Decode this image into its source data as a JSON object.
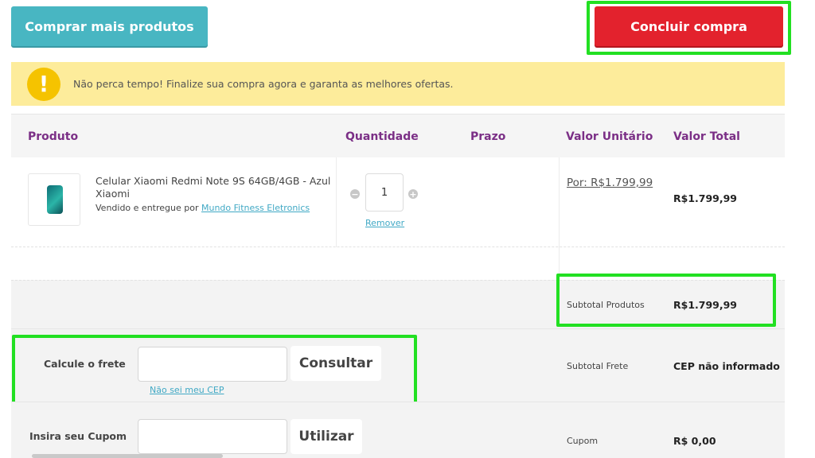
{
  "top": {
    "continue_label": "Comprar mais produtos",
    "finish_label": "Concluir compra"
  },
  "alert": {
    "icon": "!",
    "text": "Não perca tempo! Finalize sua compra agora e garanta as melhores ofertas."
  },
  "table": {
    "headers": {
      "product": "Produto",
      "quantity": "Quantidade",
      "deadline": "Prazo",
      "unit_price": "Valor Unitário",
      "total_price": "Valor Total"
    }
  },
  "item": {
    "name": "Celular Xiaomi Redmi Note 9S 64GB/4GB - Azul Xiaomi",
    "sold_by_prefix": "Vendido e entregue por",
    "seller": "Mundo Fitness Eletronics",
    "qty": "1",
    "remove_label": "Remover",
    "unit_price": "Por: R$1.799,99",
    "total": "R$1.799,99"
  },
  "summary": {
    "subtotal_label": "Subtotal Produtos",
    "subtotal_value": "R$1.799,99",
    "frete_label": "Subtotal Frete",
    "frete_value": "CEP não informado",
    "cupom_label": "Cupom",
    "cupom_value": "R$ 0,00"
  },
  "shipping": {
    "label": "Calcule o frete",
    "cep_value": "",
    "button_label": "Consultar",
    "unknown_cep_link": "Não sei meu CEP"
  },
  "coupon": {
    "label": "Insira seu Cupom",
    "value": "",
    "button_label": "Utilizar"
  },
  "colors": {
    "accent_purple": "#7b2f86",
    "teal_button": "#48b6c2",
    "red_button": "#e3222d",
    "alert_bg": "#fdec9b",
    "highlight_green": "#22e022"
  }
}
